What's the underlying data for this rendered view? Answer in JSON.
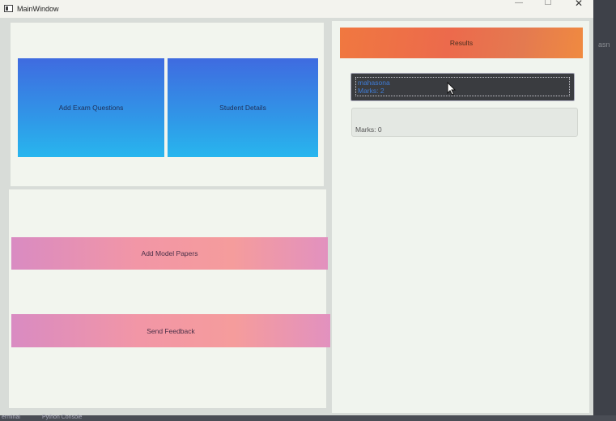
{
  "window": {
    "title": "MainWindow",
    "controls": {
      "minimize": "—",
      "maximize": "☐",
      "close": "✕"
    }
  },
  "left_panel": {
    "add_exam_label": "Add Exam Questions",
    "student_details_label": "Student Details",
    "add_model_papers_label": "Add Model Papers",
    "send_feedback_label": "Send Feedback"
  },
  "right_panel": {
    "results_label": "Results",
    "result_item": {
      "name": "mahasona",
      "marks": "Marks: 2"
    },
    "marks_display": "Marks: 0"
  },
  "taskbar": {
    "items": [
      "erminal",
      "Python Console"
    ]
  },
  "side_strip": {
    "text": "asn"
  },
  "colors": {
    "blue_button_top": "#3f6be0",
    "blue_button_bottom": "#28b6ee",
    "pink_button": "#f296a6",
    "orange_button": "#ec6a4c",
    "result_text": "#3f7cd6"
  }
}
